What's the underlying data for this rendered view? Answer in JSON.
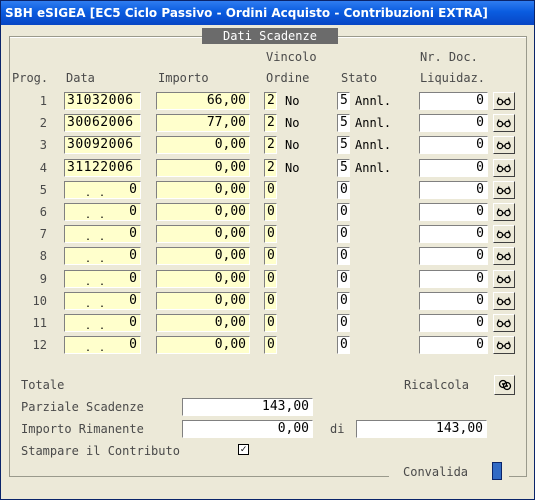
{
  "window": {
    "title": "SBH eSIGEA [EC5 Ciclo Passivo - Ordini Acquisto - Contribuzioni EXTRA]"
  },
  "section": {
    "legend": "Dati Scadenze"
  },
  "headers": {
    "prog": "Prog.",
    "data": "Data",
    "importo": "Importo",
    "vincolo": "Vincolo",
    "ordine": "Ordine",
    "stato": "Stato",
    "nr_doc": "Nr. Doc.",
    "liquidaz": "Liquidaz."
  },
  "rows": [
    {
      "prog": "1",
      "date": "31032006",
      "importo": "66,00",
      "vincolo": "2",
      "vincolo_desc": "No",
      "stato": "5",
      "stato_desc": "Annl.",
      "nrdoc": "0"
    },
    {
      "prog": "2",
      "date": "30062006",
      "importo": "77,00",
      "vincolo": "2",
      "vincolo_desc": "No",
      "stato": "5",
      "stato_desc": "Annl.",
      "nrdoc": "0"
    },
    {
      "prog": "3",
      "date": "30092006",
      "importo": "0,00",
      "vincolo": "2",
      "vincolo_desc": "No",
      "stato": "5",
      "stato_desc": "Annl.",
      "nrdoc": "0"
    },
    {
      "prog": "4",
      "date": "31122006",
      "importo": "0,00",
      "vincolo": "2",
      "vincolo_desc": "No",
      "stato": "5",
      "stato_desc": "Annl.",
      "nrdoc": "0"
    },
    {
      "prog": "5",
      "date": "",
      "date_zero": "0",
      "importo": "0,00",
      "vincolo": "0",
      "vincolo_desc": "",
      "stato": "0",
      "stato_desc": "",
      "nrdoc": "0"
    },
    {
      "prog": "6",
      "date": "",
      "date_zero": "0",
      "importo": "0,00",
      "vincolo": "0",
      "vincolo_desc": "",
      "stato": "0",
      "stato_desc": "",
      "nrdoc": "0"
    },
    {
      "prog": "7",
      "date": "",
      "date_zero": "0",
      "importo": "0,00",
      "vincolo": "0",
      "vincolo_desc": "",
      "stato": "0",
      "stato_desc": "",
      "nrdoc": "0"
    },
    {
      "prog": "8",
      "date": "",
      "date_zero": "0",
      "importo": "0,00",
      "vincolo": "0",
      "vincolo_desc": "",
      "stato": "0",
      "stato_desc": "",
      "nrdoc": "0"
    },
    {
      "prog": "9",
      "date": "",
      "date_zero": "0",
      "importo": "0,00",
      "vincolo": "0",
      "vincolo_desc": "",
      "stato": "0",
      "stato_desc": "",
      "nrdoc": "0"
    },
    {
      "prog": "10",
      "date": "",
      "date_zero": "0",
      "importo": "0,00",
      "vincolo": "0",
      "vincolo_desc": "",
      "stato": "0",
      "stato_desc": "",
      "nrdoc": "0"
    },
    {
      "prog": "11",
      "date": "",
      "date_zero": "0",
      "importo": "0,00",
      "vincolo": "0",
      "vincolo_desc": "",
      "stato": "0",
      "stato_desc": "",
      "nrdoc": "0"
    },
    {
      "prog": "12",
      "date": "",
      "date_zero": "0",
      "importo": "0,00",
      "vincolo": "0",
      "vincolo_desc": "",
      "stato": "0",
      "stato_desc": "",
      "nrdoc": "0"
    }
  ],
  "footer": {
    "totale_label": "Totale",
    "ricalcola_label": "Ricalcola",
    "parziale_label": "Parziale Scadenze",
    "parziale_value": "143,00",
    "rimanente_label": "Importo Rimanente",
    "rimanente_value": "0,00",
    "di_label": "di",
    "di_value": "143,00",
    "stampare_label": "Stampare il Contributo",
    "stampare_checked": "✓",
    "convalida_label": "Convalida"
  },
  "colors": {
    "titlebar": "#0a5ce0",
    "field_bg": "#ffffcc",
    "convalida": "#316ac5"
  },
  "icons": {
    "row_button": "glasses-icon",
    "ricalcola": "recalc-icon"
  }
}
